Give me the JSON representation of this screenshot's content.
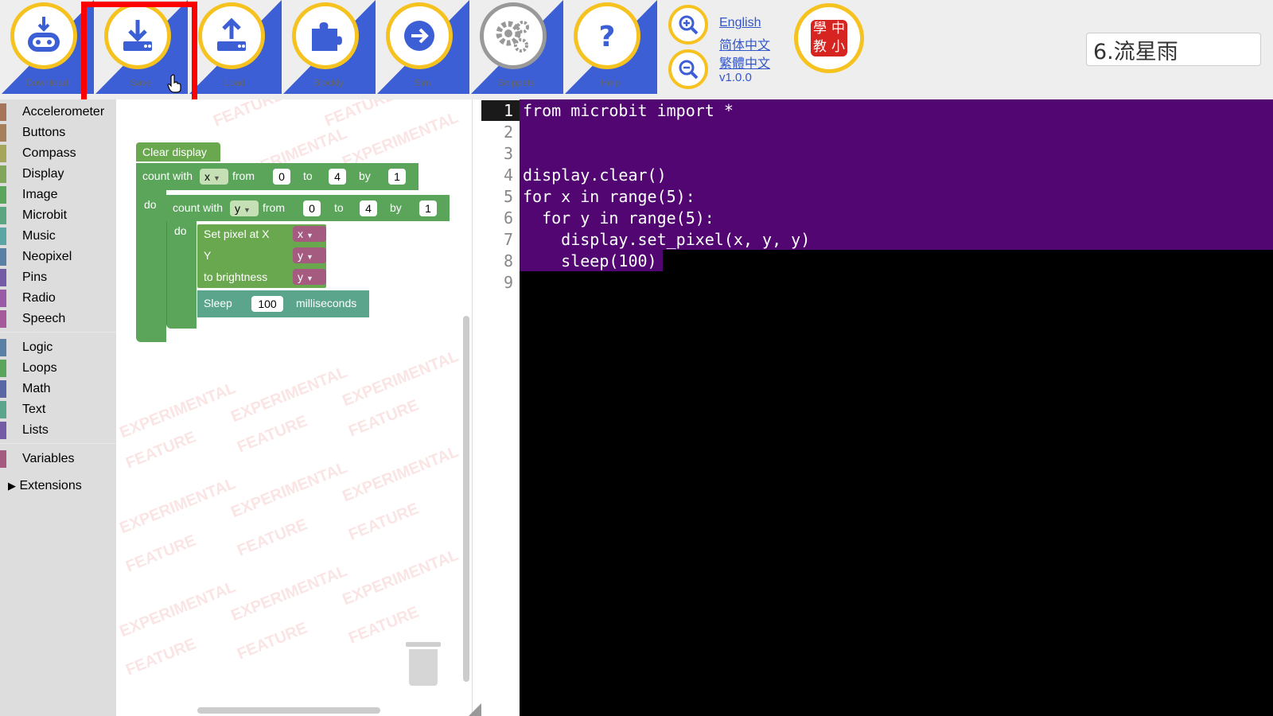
{
  "toolbar": {
    "buttons": [
      {
        "label": "Download",
        "icon": "download-device-icon"
      },
      {
        "label": "Save",
        "icon": "save-download-icon"
      },
      {
        "label": "Load",
        "icon": "load-upload-icon"
      },
      {
        "label": "Blockly",
        "icon": "puzzle-icon"
      },
      {
        "label": "Sim",
        "icon": "arrow-right-icon"
      },
      {
        "label": "Snippets",
        "icon": "gears-icon"
      },
      {
        "label": "Help",
        "icon": "question-icon"
      }
    ],
    "languages": [
      "English",
      "简体中文",
      "繁體中文"
    ],
    "version": "v1.0.0",
    "logo_text": "中小教學"
  },
  "project_name": "6.流星雨",
  "categories": {
    "group1": [
      "Accelerometer",
      "Buttons",
      "Compass",
      "Display",
      "Image",
      "Microbit",
      "Music",
      "Neopixel",
      "Pins",
      "Radio",
      "Speech"
    ],
    "group2": [
      "Logic",
      "Loops",
      "Math",
      "Text",
      "Lists"
    ],
    "variables": "Variables",
    "extensions": "Extensions"
  },
  "colors": {
    "toolbar_accent": "#3d5fd6",
    "button_ring": "#f6c21f",
    "loop_block": "#5ba55b",
    "display_block": "#6aa84f",
    "sleep_block": "#5ba58c",
    "variable_block": "#a55b80",
    "code_highlight": "#520672",
    "save_highlight": "#ff0000"
  },
  "watermark": {
    "line1": "FEATURE",
    "line2": "EXPERIMENTAL"
  },
  "blocks": {
    "clear_display": "Clear display",
    "outer_loop": {
      "count_with": "count with",
      "var": "x",
      "from": "from",
      "from_val": "0",
      "to": "to",
      "to_val": "4",
      "by": "by",
      "by_val": "1",
      "do": "do"
    },
    "inner_loop": {
      "count_with": "count with",
      "var": "y",
      "from": "from",
      "from_val": "0",
      "to": "to",
      "to_val": "4",
      "by": "by",
      "by_val": "1",
      "do": "do"
    },
    "set_pixel": {
      "label_x": "Set pixel at X",
      "label_y": "Y",
      "label_b": "to brightness",
      "x": "x",
      "y": "y",
      "b": "y"
    },
    "sleep": {
      "label": "Sleep",
      "value": "100",
      "unit": "milliseconds"
    }
  },
  "code": {
    "line_numbers": [
      "1",
      "2",
      "3",
      "4",
      "5",
      "6",
      "7",
      "8",
      "9"
    ],
    "lines": [
      "from microbit import *",
      "",
      "",
      "display.clear()",
      "for x in range(5):",
      "  for y in range(5):",
      "    display.set_pixel(x, y, y)",
      "    sleep(100)",
      ""
    ]
  }
}
